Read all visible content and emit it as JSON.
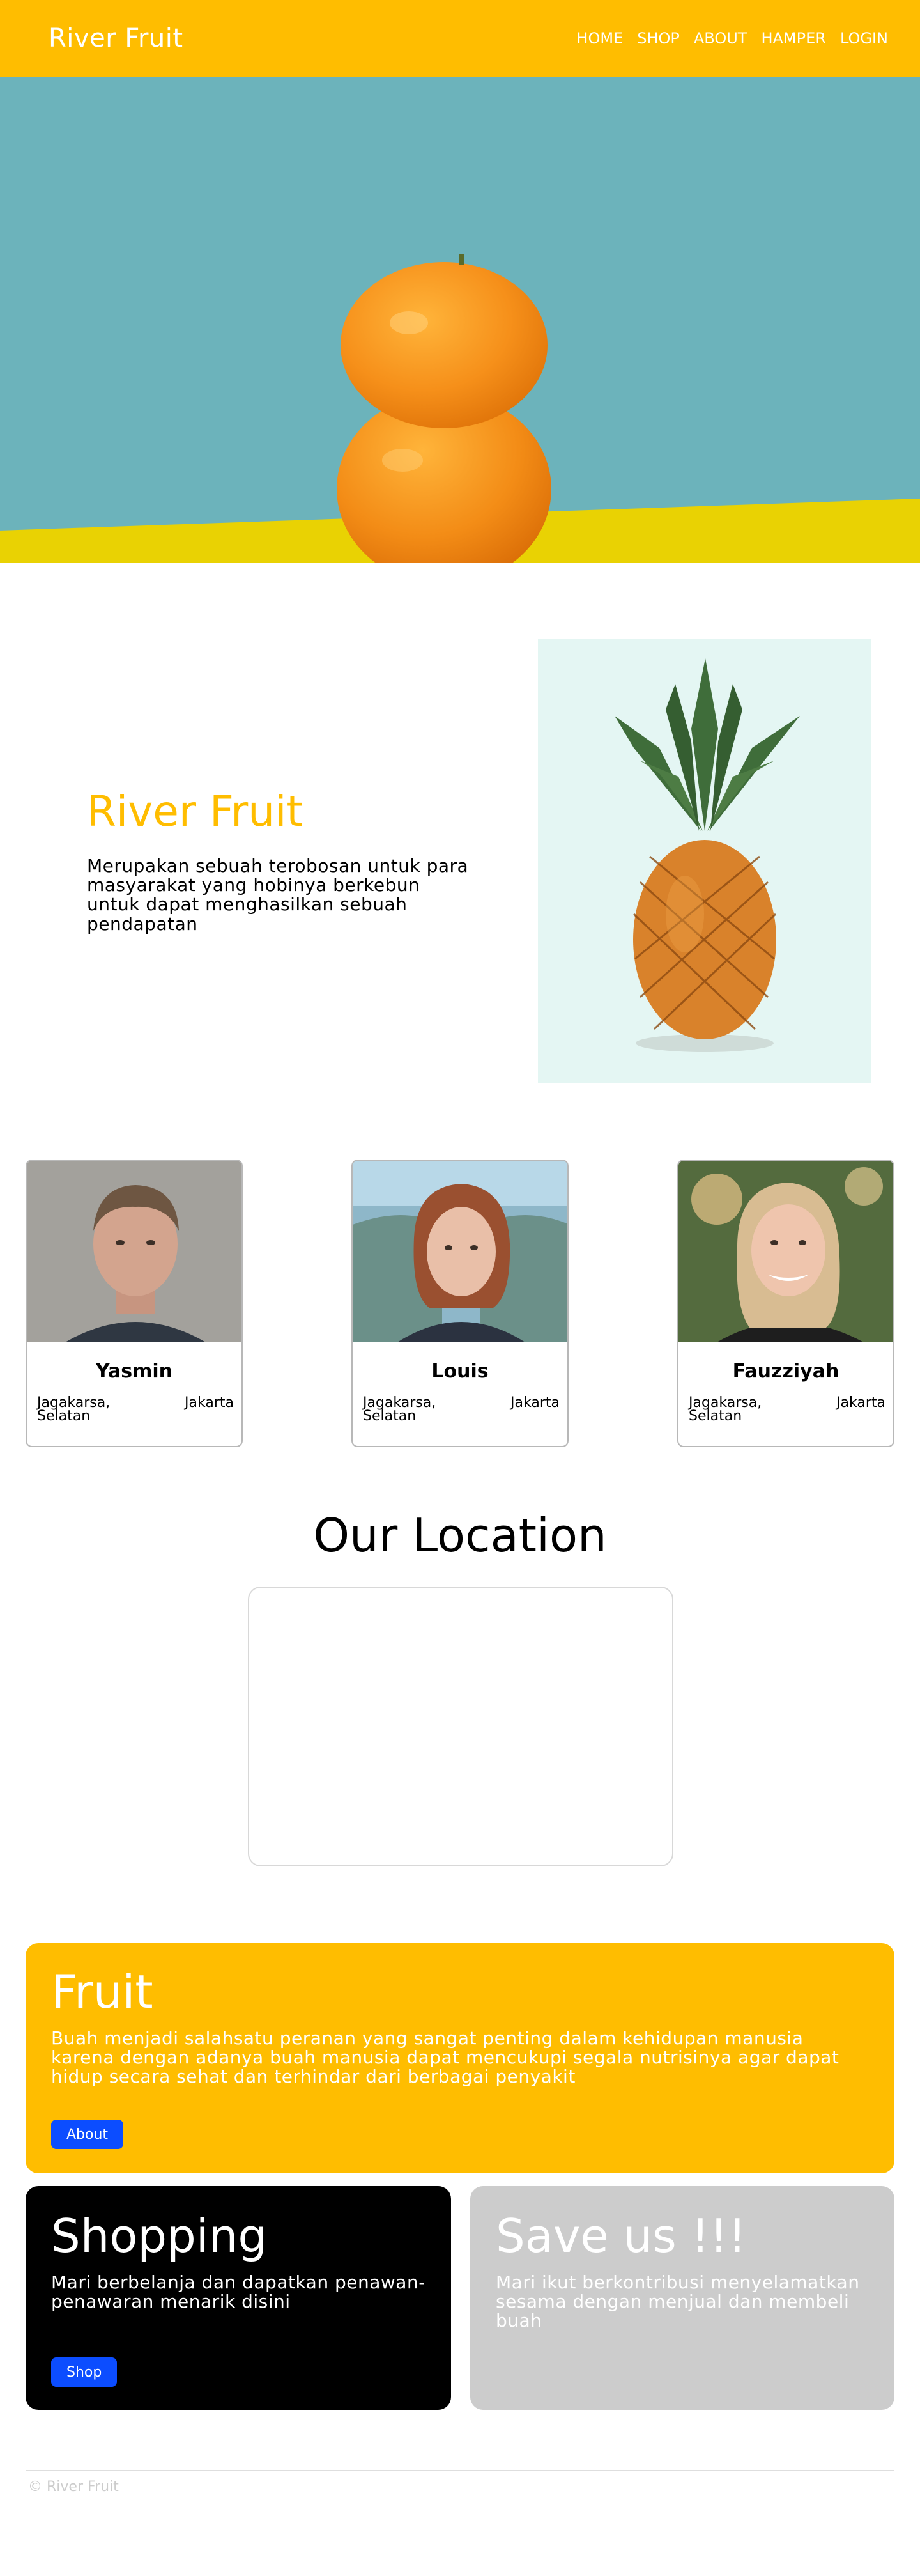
{
  "header": {
    "brand": "River Fruit",
    "nav": [
      "HOME",
      "SHOP",
      "ABOUT",
      "HAMPER",
      "LOGIN"
    ]
  },
  "hero": {
    "image": "oranges-stacked-photo"
  },
  "about": {
    "title": "River Fruit",
    "text": "Merupakan sebuah terobosan untuk para masyarakat yang hobinya berkebun untuk dapat menghasilkan sebuah pendapatan",
    "image": "pineapple-photo"
  },
  "team": [
    {
      "name": "Yasmin",
      "area": "Jagakarsa, Selatan",
      "city": "Jakarta",
      "photo": "man-portrait"
    },
    {
      "name": "Louis",
      "area": "Jagakarsa, Selatan",
      "city": "Jakarta",
      "photo": "woman-portrait-red-hair"
    },
    {
      "name": "Fauzziyah",
      "area": "Jagakarsa, Selatan",
      "city": "Jakarta",
      "photo": "woman-portrait-blonde"
    }
  ],
  "location": {
    "title": "Our Location"
  },
  "panels": {
    "fruit": {
      "title": "Fruit",
      "text": "Buah menjadi salahsatu peranan yang sangat penting dalam kehidupan manusia karena dengan adanya buah manusia dapat mencukupi segala nutrisinya agar dapat hidup secara sehat dan terhindar dari berbagai penyakit",
      "button": "About"
    },
    "shopping": {
      "title": "Shopping",
      "text": "Mari berbelanja dan dapatkan penawan-penawaran menarik disini",
      "button": "Shop"
    },
    "save": {
      "title": "Save us !!!",
      "text": "Mari ikut berkontribusi menyelamatkan sesama dengan menjual dan membeli buah"
    }
  },
  "footer": {
    "text": "© River Fruit"
  },
  "colors": {
    "brand": "#ffbd00",
    "button": "#0c4dff",
    "panel_dark": "#000000",
    "panel_gray": "#cccccc"
  }
}
